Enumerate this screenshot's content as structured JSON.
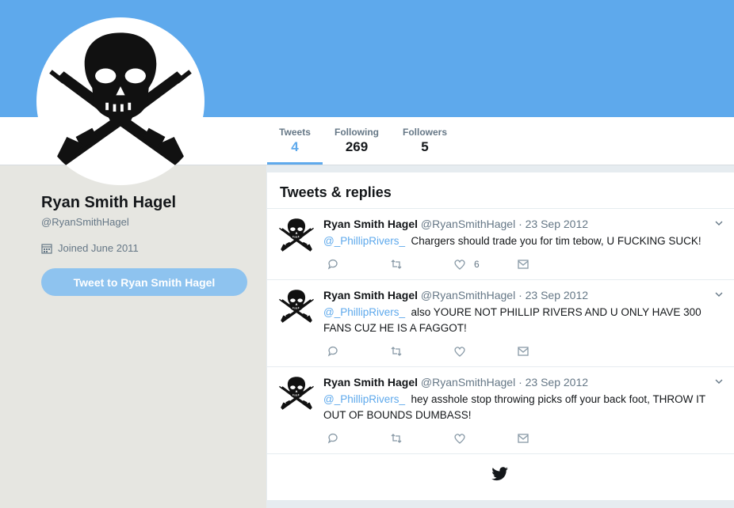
{
  "profile": {
    "name": "Ryan Smith Hagel",
    "handle": "@RyanSmithHagel",
    "joined": "Joined June 2011",
    "tweet_to_label": "Tweet to Ryan Smith Hagel"
  },
  "stats": [
    {
      "label": "Tweets",
      "value": "4"
    },
    {
      "label": "Following",
      "value": "269"
    },
    {
      "label": "Followers",
      "value": "5"
    }
  ],
  "timeline": {
    "title": "Tweets & replies",
    "tweets": [
      {
        "name": "Ryan Smith Hagel",
        "meta": "@RyanSmithHagel · 23 Sep 2012",
        "mention": "@_PhillipRivers_",
        "text": "Chargers should trade you for tim tebow, U FUCKING SUCK!",
        "likes": "6"
      },
      {
        "name": "Ryan Smith Hagel",
        "meta": "@RyanSmithHagel · 23 Sep 2012",
        "mention": "@_PhillipRivers_",
        "text": "also YOURE NOT PHILLIP RIVERS AND U ONLY HAVE 300 FANS CUZ HE IS A FAGGOT!",
        "likes": ""
      },
      {
        "name": "Ryan Smith Hagel",
        "meta": "@RyanSmithHagel · 23 Sep 2012",
        "mention": "@_PhillipRivers_",
        "text": "hey asshole stop throwing picks off your back foot, THROW IT OUT OF BOUNDS DUMBASS!",
        "likes": ""
      }
    ]
  },
  "icons": {
    "reply": "reply-icon",
    "retweet": "retweet-icon",
    "like": "heart-icon",
    "message": "envelope-icon",
    "calendar": "calendar-icon",
    "footer": "twitter-bird-icon"
  },
  "colors": {
    "banner": "#5ea9ec",
    "accent": "#5ea9ec",
    "button": "#8ec3ef"
  }
}
